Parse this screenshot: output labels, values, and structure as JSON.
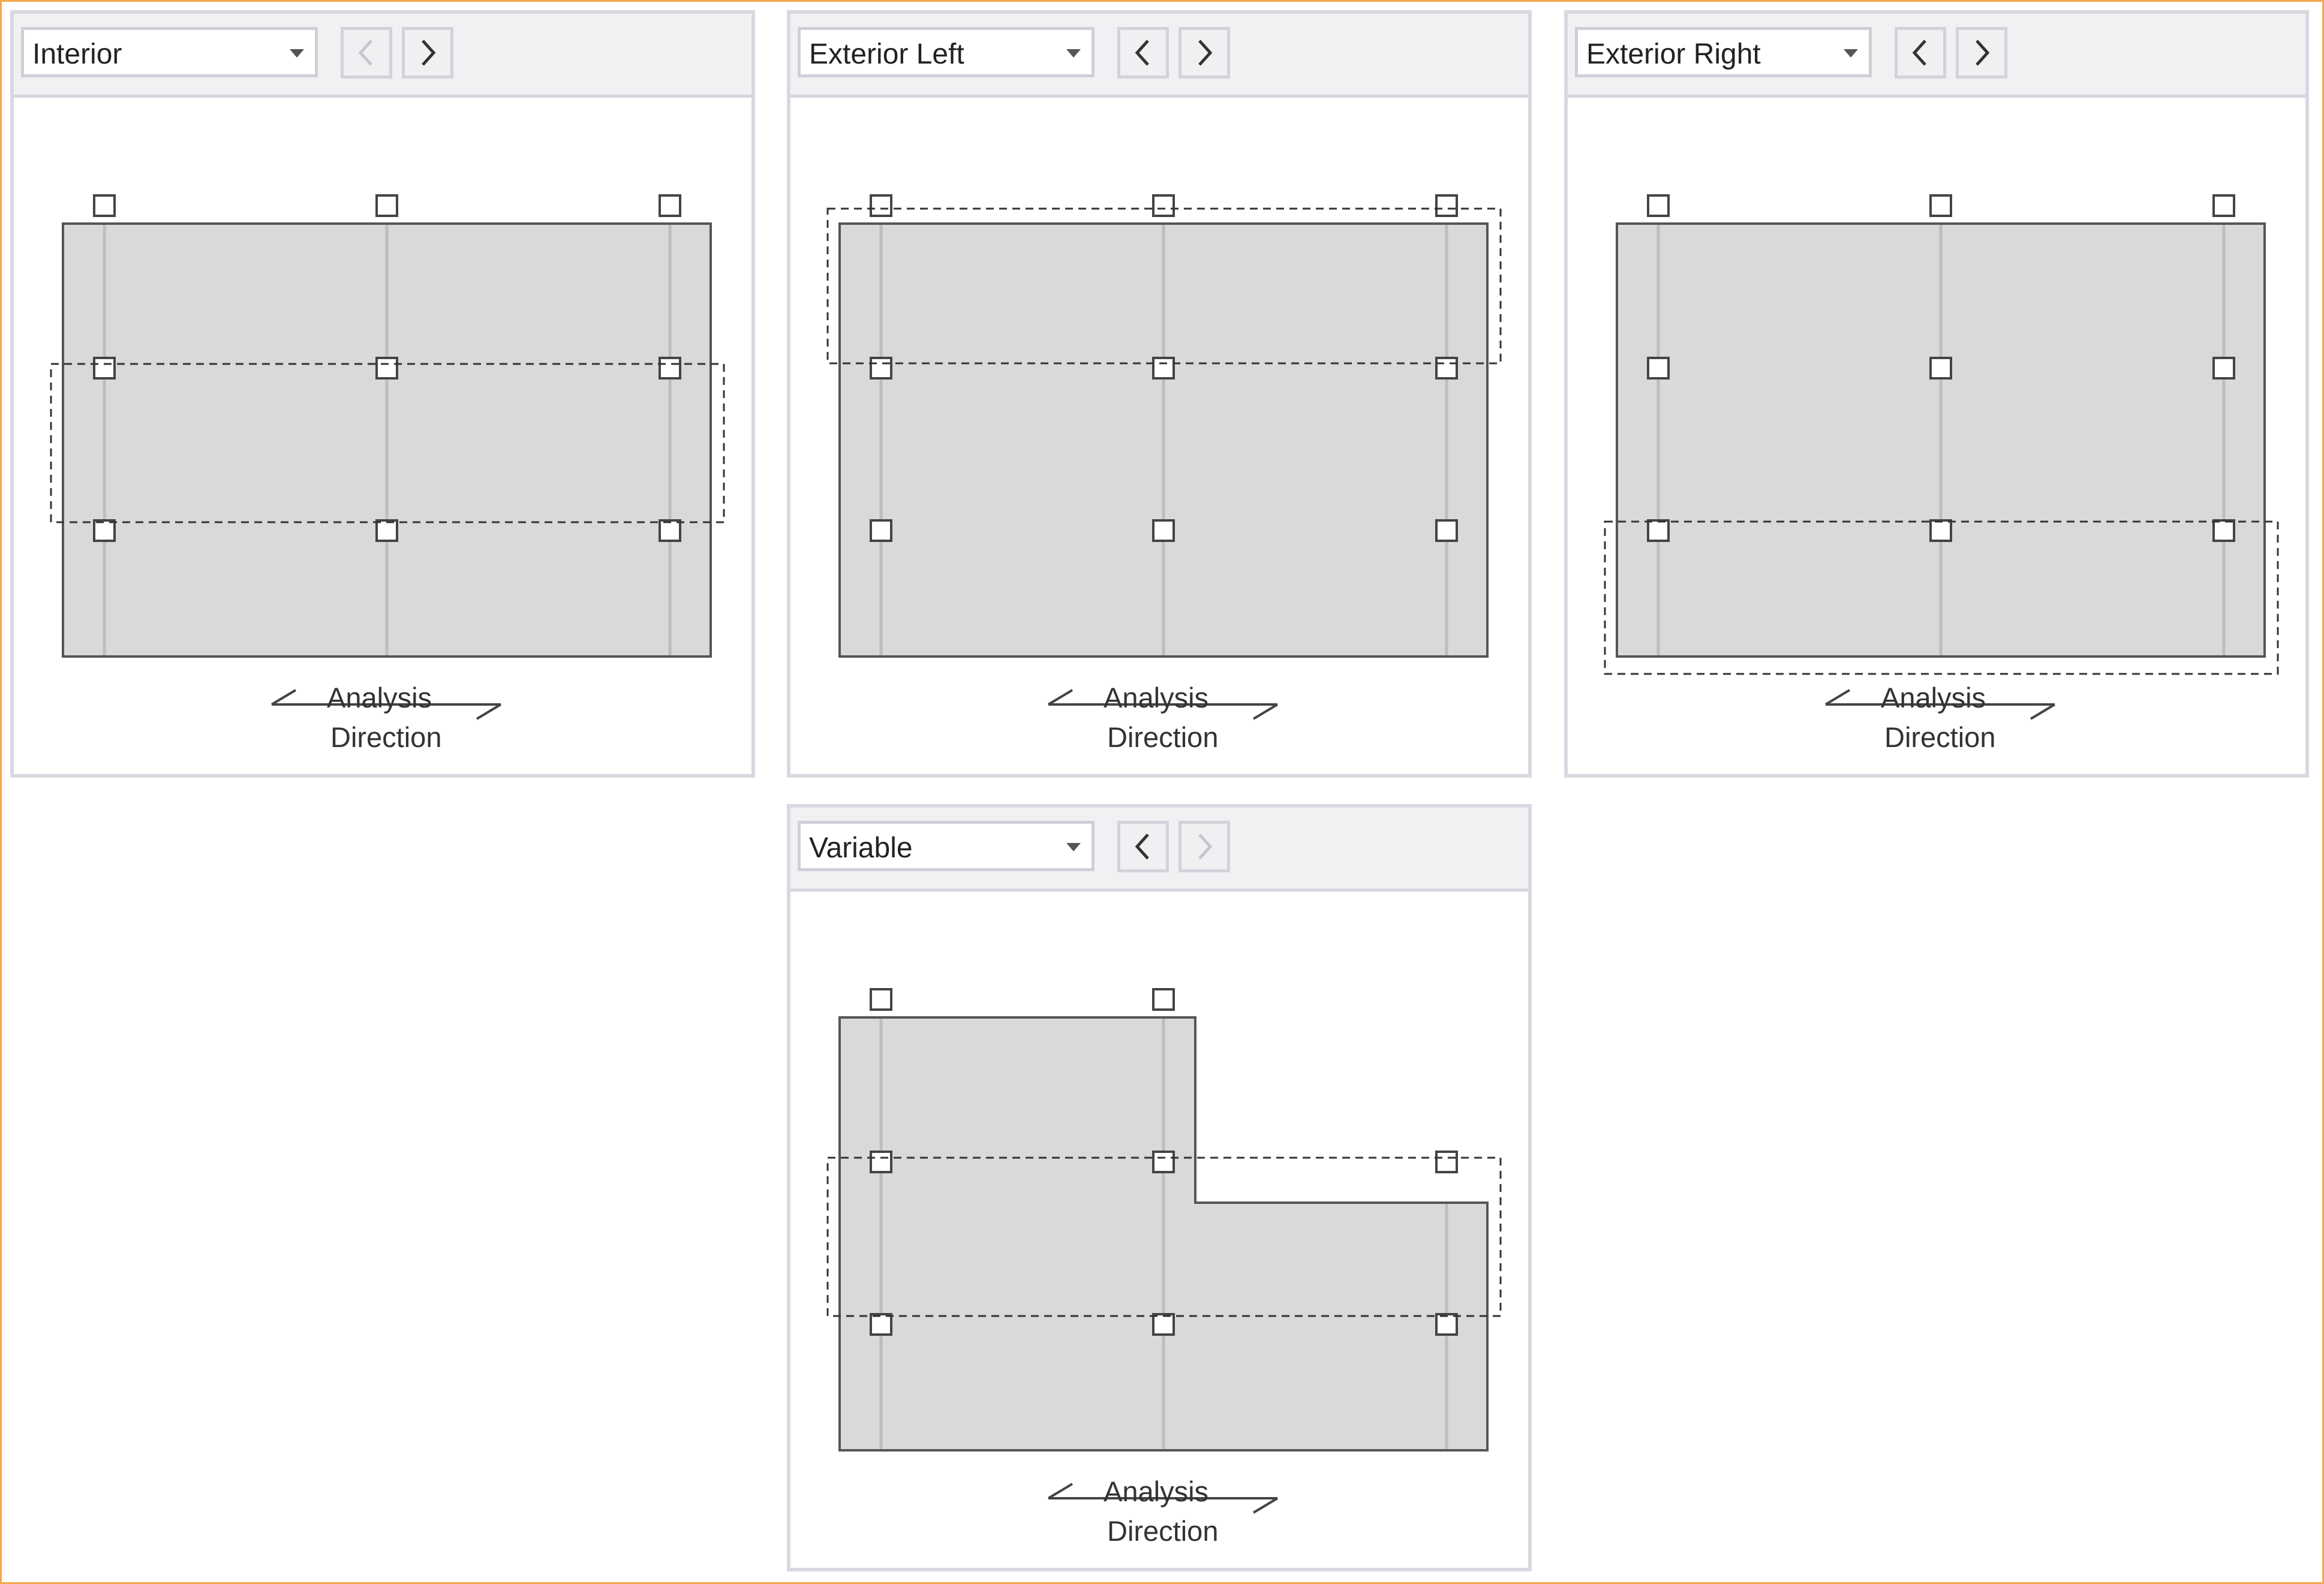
{
  "panels": [
    {
      "name": "interior",
      "dropdown": {
        "selected": "Interior"
      },
      "nav": {
        "prev_enabled": false,
        "next_enabled": true
      },
      "shape": "rectangle",
      "strip": "middle",
      "direction": {
        "line1": "Analysis",
        "line2": "Direction"
      }
    },
    {
      "name": "exterior-left",
      "dropdown": {
        "selected": "Exterior Left"
      },
      "nav": {
        "prev_enabled": true,
        "next_enabled": true
      },
      "shape": "rectangle",
      "strip": "top",
      "direction": {
        "line1": "Analysis",
        "line2": "Direction"
      }
    },
    {
      "name": "exterior-right",
      "dropdown": {
        "selected": "Exterior Right"
      },
      "nav": {
        "prev_enabled": true,
        "next_enabled": true
      },
      "shape": "rectangle",
      "strip": "bottom",
      "direction": {
        "line1": "Analysis",
        "line2": "Direction"
      }
    },
    {
      "name": "variable",
      "dropdown": {
        "selected": "Variable"
      },
      "nav": {
        "prev_enabled": true,
        "next_enabled": false
      },
      "shape": "l-shape",
      "strip": "middle",
      "direction": {
        "line1": "Analysis",
        "line2": "Direction"
      }
    }
  ],
  "icons": {
    "dropdown": "chevron-down-icon",
    "prev": "chevron-left-icon",
    "next": "chevron-right-icon",
    "column": "column-square-icon",
    "direction": "analysis-direction-arrow-icon"
  },
  "colors": {
    "frame_border": "#f2a94e",
    "slab_fill": "#d9d9d9",
    "slab_stroke": "#555555",
    "gridline": "#bdbdbd",
    "strip_dash": "#333333",
    "disabled_icon": "#c6c6cc",
    "enabled_icon": "#333333"
  }
}
